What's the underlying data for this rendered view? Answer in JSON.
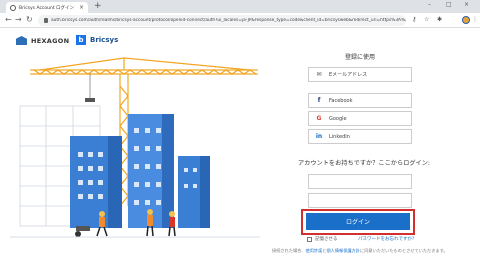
{
  "browser": {
    "tab_title": "Bricsys Account ログイン",
    "url": "auth.bricsys.com/auth/realms/bricsys-account/protocol/openid-connect/auth?ui_locales=ja-JP&response_type=code&client_id=bricsysweb&redirect_uri=https%3A%2F..."
  },
  "header": {
    "hexagon_logo_text": "HEXAGON",
    "bricsys_logo_text": "Bricsys"
  },
  "login": {
    "title": "登録に使用",
    "email_label": "Eメールアドレス",
    "facebook_label": "Facebook",
    "google_label": "Google",
    "linkedin_label": "LinkedIn",
    "question": "アカウントをお持ちですか？ここからログイン:",
    "login_button": "ログイン",
    "remember_label": "記憶させる",
    "forgot_label": "パスワードをお忘れですか?"
  },
  "footer": {
    "prefix": "接続された場合、",
    "terms": "使用許諾",
    "middle": "と",
    "privacy": "個人情報保護方針",
    "suffix": "に同意いただいたものとさせていただきます。"
  },
  "colors": {
    "primary": "#1a6fc9",
    "highlight": "#d32f2f",
    "facebook": "#1c3a72",
    "google": "#db4437",
    "linkedin": "#0a66c2"
  }
}
